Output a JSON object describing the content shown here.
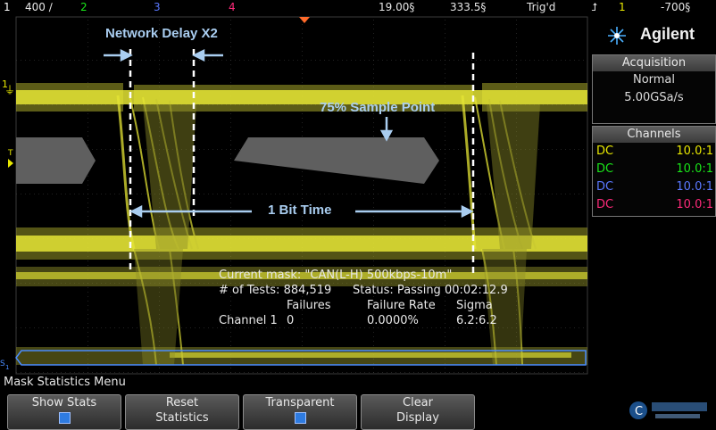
{
  "topbar": {
    "ch1_label": "1",
    "ch1_scale": "400 ∕",
    "ch2_label": "2",
    "ch3_label": "3",
    "ch4_label": "4",
    "timebase": "19.00§",
    "delay": "333.5§",
    "trigger_status": "Trig'd",
    "trig_slope_icon": "rising-edge-icon",
    "trig_channel": "1",
    "trig_level": "-700§"
  },
  "annotations": {
    "network_delay": "Network Delay X2",
    "sample_point": "75% Sample Point",
    "bit_time": "1 Bit Time"
  },
  "mask_stats": {
    "current_mask": "Current mask: \"CAN(L-H) 500kbps-10m\"",
    "tests": "# of Tests: 884,519",
    "status": "Status: Passing 00:02:12.9",
    "col_failures": "Failures",
    "col_rate": "Failure Rate",
    "col_sigma": "Sigma",
    "row_label": "Channel 1",
    "failures": "0",
    "rate": "0.0000%",
    "sigma": "6.2:6.2"
  },
  "side": {
    "brand": "Agilent",
    "acq_title": "Acquisition",
    "acq_mode": "Normal",
    "acq_rate": "5.00GSa/s",
    "ch_title": "Channels",
    "channels": [
      {
        "coupling": "DC",
        "probe": "10.0:1",
        "color": "#e8e800"
      },
      {
        "coupling": "DC",
        "probe": "10.0:1",
        "color": "#19e619"
      },
      {
        "coupling": "DC",
        "probe": "10.0:1",
        "color": "#5a78ff"
      },
      {
        "coupling": "DC",
        "probe": "10.0:1",
        "color": "#ff2a7a"
      }
    ]
  },
  "menu": {
    "title": "Mask Statistics Menu",
    "keys": [
      {
        "line1": "Show Stats",
        "line2": ""
      },
      {
        "line1": "Reset",
        "line2": "Statistics"
      },
      {
        "line1": "Transparent",
        "line2": ""
      },
      {
        "line1": "Clear",
        "line2": "Display"
      }
    ]
  },
  "colors": {
    "trace": "#e5e535",
    "annotation": "#a9cdf0",
    "mask_region": "#5f5f5f"
  }
}
